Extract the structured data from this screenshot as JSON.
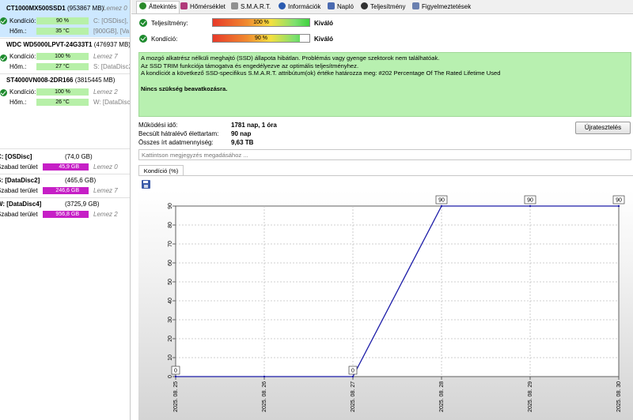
{
  "drives": [
    {
      "model": "CT1000MX500SSD1",
      "capacity": "(953867 MB)",
      "disk": "Lemez 0",
      "condition_label": "Kondíció:",
      "condition_value": "90 %",
      "temp_label": "Hőm.:",
      "temp_value": "35 °C",
      "partition_line1": "C: [OSDisc],",
      "partition_line2": "[900GB], [Va"
    },
    {
      "model": "WDC WD5000LPVT-24G33T1",
      "capacity": "(476937 MB)",
      "disk": "Lemez 7",
      "condition_label": "Kondíció:",
      "condition_value": "100 %",
      "temp_label": "Hőm.:",
      "temp_value": "27 °C",
      "partition_line1": "S: [DataDisc2]"
    },
    {
      "model": "ST4000VN008-2DR166",
      "capacity": "(3815445 MB)",
      "disk": "Lemez 2",
      "condition_label": "Kondíció:",
      "condition_value": "100 %",
      "temp_label": "Hőm.:",
      "temp_value": "26 °C",
      "partition_line1": "W: [DataDisc"
    }
  ],
  "volumes": [
    {
      "name": "C: [OSDisc]",
      "capacity": "(74,0 GB)",
      "free_label": "Szabad terület",
      "free_value": "45,9 GB",
      "disk": "Lemez 0"
    },
    {
      "name": "S: [DataDisc2]",
      "capacity": "(465,6 GB)",
      "free_label": "Szabad terület",
      "free_value": "246,6 GB",
      "disk": "Lemez 7"
    },
    {
      "name": "W: [DataDisc4]",
      "capacity": "(3725,9 GB)",
      "free_label": "Szabad terület",
      "free_value": "956,8 GB",
      "disk": "Lemez 2"
    }
  ],
  "tabs": [
    {
      "label": "Áttekintés",
      "icon": "overview-icon",
      "color": "#2a8a2a"
    },
    {
      "label": "Hőmérséklet",
      "icon": "thermometer-icon",
      "color": "#b03a7a"
    },
    {
      "label": "S.M.A.R.T.",
      "icon": "smart-icon",
      "color": "#707070"
    },
    {
      "label": "Információk",
      "icon": "info-icon",
      "color": "#2a5ab0"
    },
    {
      "label": "Napló",
      "icon": "log-icon",
      "color": "#4a6ab0"
    },
    {
      "label": "Teljesítmény",
      "icon": "performance-icon",
      "color": "#303030"
    },
    {
      "label": "Figyelmeztetések",
      "icon": "alerts-icon",
      "color": "#6a80b0"
    }
  ],
  "status": {
    "performance_label": "Teljesítmény:",
    "performance_value": "100 %",
    "performance_percent": 100,
    "performance_rating": "Kiváló",
    "condition_label": "Kondíció:",
    "condition_value": "90 %",
    "condition_percent": 90,
    "condition_rating": "Kiváló"
  },
  "message": {
    "line1": "A mozgó alkatrész nélküli meghajtó (SSD) állapota hibátlan. Problémás vagy gyenge szektorok nem találhatóak.",
    "line2": "Az SSD TRIM funkciója támogatva és engedélyezve az optimális teljesítményhez.",
    "line3": "A kondíciót a következő SSD-specifikus S.M.A.R.T. attribútum(ok) értéke határozza meg:  #202 Percentage Of The Rated Lifetime Used",
    "action": "Nincs szükség beavatkozásra."
  },
  "info": {
    "uptime_label": "Működési idő:",
    "uptime_value": "1781 nap, 1 óra",
    "remaining_label": "Becsült hátralévő élettartam:",
    "remaining_value": "90 nap",
    "written_label": "Összes írt adatmennyiség:",
    "written_value": "9,63 TB",
    "retest_button": "Újratesztelés"
  },
  "comment_placeholder": "Kattintson megjegyzés megadásához ...",
  "chart_tab": "Kondíció  (%)",
  "chart_data": {
    "type": "line",
    "x": [
      "2025. 08. 25",
      "2025. 08. 26",
      "2025. 08. 27",
      "2025. 08. 28",
      "2025. 08. 29",
      "2025. 08. 30"
    ],
    "points": [
      {
        "x": "2025. 08. 25",
        "y": 0
      },
      {
        "x": "2025. 08. 26",
        "y": 0
      },
      {
        "x": "2025. 08. 27",
        "y": 0
      },
      {
        "x": "2025. 08. 28",
        "y": 90
      },
      {
        "x": "2025. 08. 29",
        "y": 90
      },
      {
        "x": "2025. 08. 30",
        "y": 90
      }
    ],
    "labeled_points": [
      0,
      2,
      3,
      4,
      5
    ],
    "labeled_values": [
      "0",
      "0",
      "0",
      "90",
      "90",
      "90"
    ],
    "ylim": [
      0,
      90
    ],
    "yticks": [
      0,
      10,
      20,
      30,
      40,
      50,
      60,
      70,
      80,
      90
    ],
    "grid": true,
    "line_color": "#1c1ca8"
  }
}
